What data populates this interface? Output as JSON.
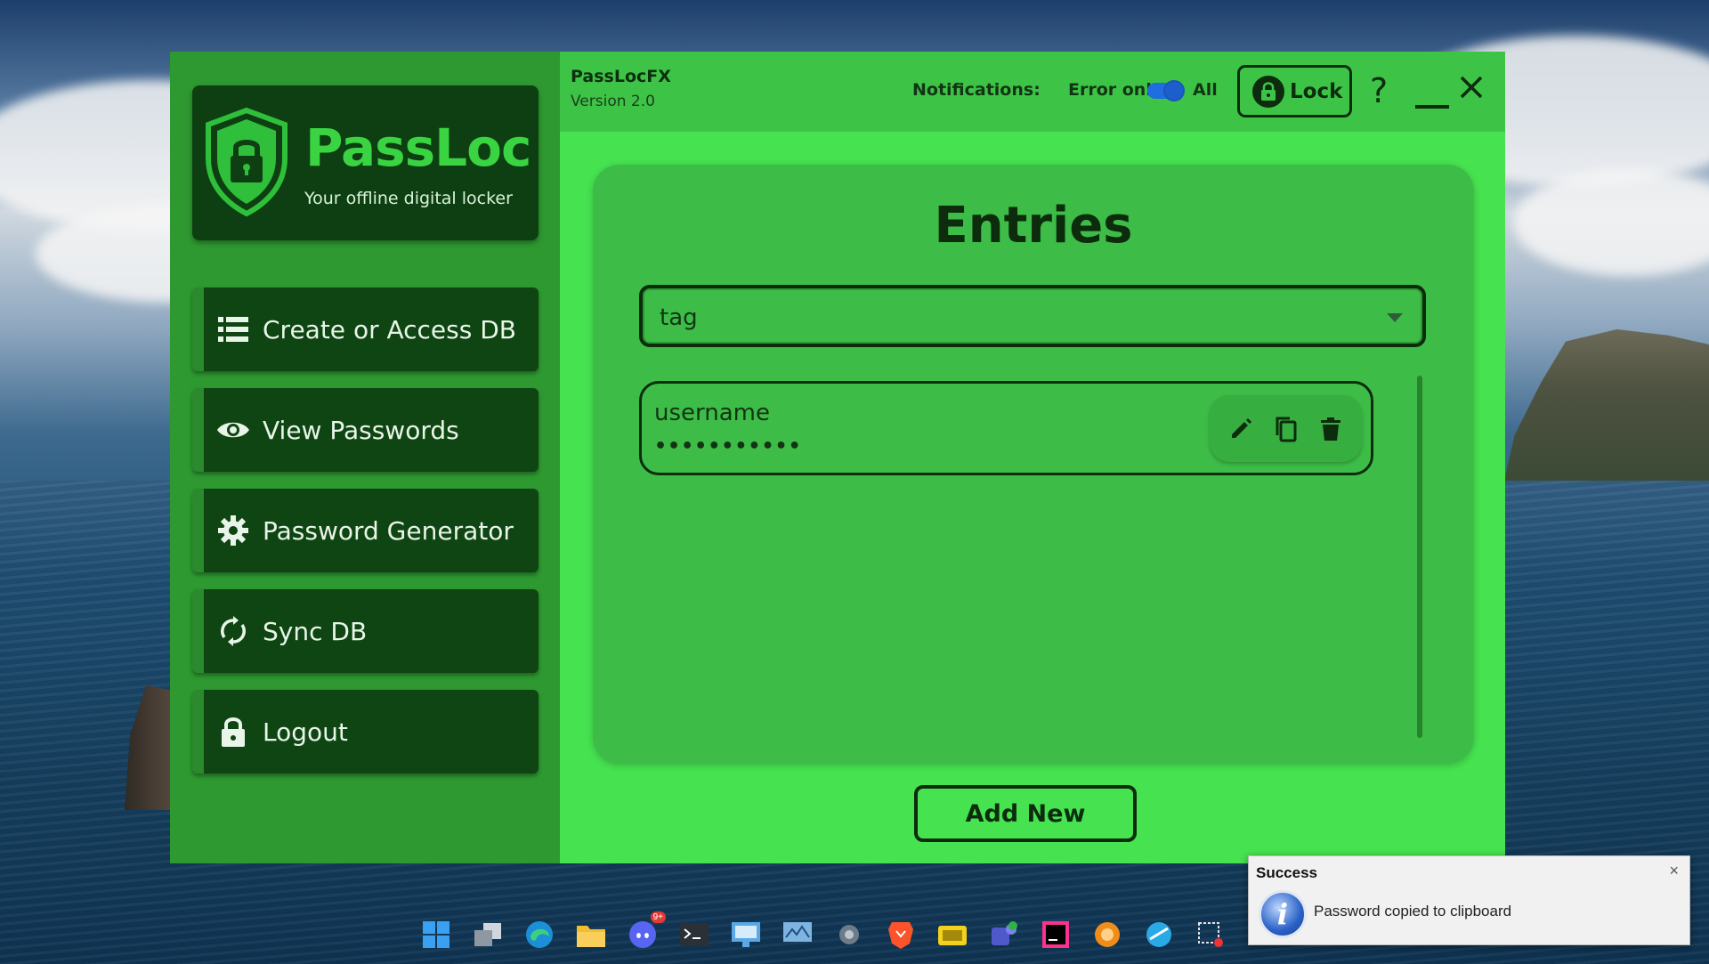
{
  "window": {
    "app_name": "PassLocFX",
    "version": "Version 2.0"
  },
  "brand": {
    "title": "PassLoc",
    "subtitle": "Your offline digital locker"
  },
  "sidebar": {
    "items": [
      {
        "label": "Create or Access DB",
        "icon": "database-icon"
      },
      {
        "label": "View Passwords",
        "icon": "eye-icon"
      },
      {
        "label": "Password Generator",
        "icon": "gear-icon"
      },
      {
        "label": "Sync DB",
        "icon": "sync-icon"
      },
      {
        "label": "Logout",
        "icon": "lock-icon"
      }
    ]
  },
  "header": {
    "notifications_label": "Notifications:",
    "option_error": "Error only",
    "option_all": "All",
    "toggle_state": "All",
    "lock_label": "Lock",
    "help_label": "?"
  },
  "entries": {
    "title": "Entries",
    "tag_selected": "tag",
    "items": [
      {
        "username": "username",
        "password_mask": "•••••••••••"
      }
    ],
    "add_label": "Add New"
  },
  "toast": {
    "title": "Success",
    "close": "×",
    "message": "Password copied to clipboard"
  },
  "colors": {
    "sidebar_bg": "#2e9930",
    "main_bg": "#46e250",
    "nav_bg": "#0f4512",
    "text_dark": "#0c2c0d",
    "brand_green": "#3ad443"
  },
  "taskbar": {
    "icons": [
      "windows-start-icon",
      "task-view-icon",
      "edge-icon",
      "file-explorer-icon",
      "discord-icon",
      "terminal-icon",
      "remote-desktop-icon",
      "monitor-icon",
      "settings-icon",
      "brave-icon",
      "pdf-icon",
      "teams-icon",
      "jetbrains-icon",
      "app-icon",
      "browser-icon",
      "snipping-icon"
    ],
    "discord_badge": "9+"
  }
}
